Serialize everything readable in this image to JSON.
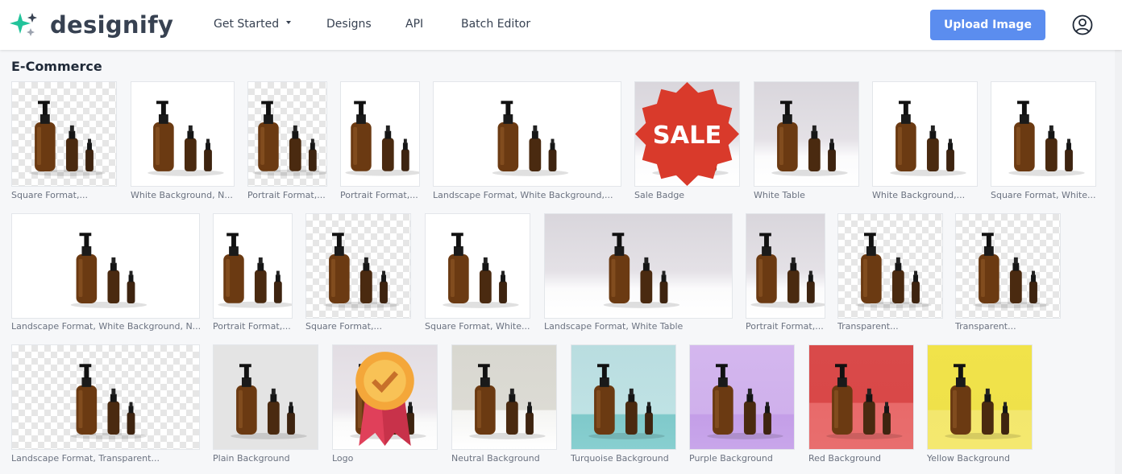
{
  "brand": {
    "name": "designify"
  },
  "nav": {
    "items": [
      {
        "label": "Get Started",
        "dropdown": true
      },
      {
        "label": "Designs"
      },
      {
        "label": "API"
      },
      {
        "label": "Batch Editor"
      }
    ]
  },
  "upload_button": {
    "label": "Upload Image"
  },
  "section": {
    "title": "E-Commerce"
  },
  "colors": {
    "brand_star": "#22c39a",
    "upload": "#5b8def",
    "text": "#374151",
    "sale_badge": "#d93a2b"
  },
  "tiles": [
    {
      "caption": "Square Format,...",
      "bg": "checker"
    },
    {
      "caption": "White Background, N...",
      "bg": "white"
    },
    {
      "caption": "Portrait Format,...",
      "bg": "checker"
    },
    {
      "caption": "Portrait Format,...",
      "bg": "white"
    },
    {
      "caption": "Landscape Format, White Background,...",
      "bg": "white"
    },
    {
      "caption": "Sale Badge",
      "bg": "table",
      "badge": "SALE"
    },
    {
      "caption": "White Table",
      "bg": "table"
    },
    {
      "caption": "White Background,...",
      "bg": "white"
    },
    {
      "caption": "Square Format, White...",
      "bg": "white"
    },
    {
      "caption": "Landscape Format, White Background, N...",
      "bg": "white"
    },
    {
      "caption": "Portrait Format,...",
      "bg": "white"
    },
    {
      "caption": "Square Format,...",
      "bg": "checker"
    },
    {
      "caption": "Square Format, White...",
      "bg": "white"
    },
    {
      "caption": "Landscape Format, White Table",
      "bg": "table"
    },
    {
      "caption": "Portrait Format,...",
      "bg": "table"
    },
    {
      "caption": "Transparent...",
      "bg": "checker"
    },
    {
      "caption": "Transparent...",
      "bg": "checker"
    },
    {
      "caption": "Landscape Format, Transparent...",
      "bg": "checker"
    },
    {
      "caption": "Plain Background",
      "bg": "plain"
    },
    {
      "caption": "Logo",
      "bg": "logo"
    },
    {
      "caption": "Neutral Background",
      "bg": "neutral"
    },
    {
      "caption": "Turquoise Background",
      "bg": "turquoise"
    },
    {
      "caption": "Purple Background",
      "bg": "purple"
    },
    {
      "caption": "Red Background",
      "bg": "red"
    },
    {
      "caption": "Yellow Background",
      "bg": "yellow"
    }
  ]
}
